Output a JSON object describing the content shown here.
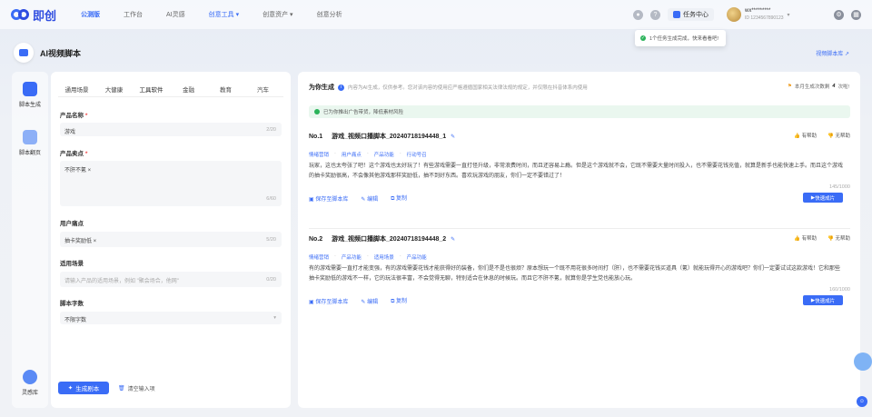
{
  "app": {
    "logo_text": "即创"
  },
  "nav": [
    {
      "label": "公测版",
      "active": true
    },
    {
      "label": "工作台"
    },
    {
      "label": "AI灵感"
    },
    {
      "label": "创意工具 ▾",
      "highlight": true
    },
    {
      "label": "创意资产 ▾"
    },
    {
      "label": "创意分析"
    }
  ],
  "top": {
    "tasks_label": "任务中心",
    "user_name": "wx*********",
    "user_sub": "ID 1234567890123"
  },
  "toast": {
    "text": "1个任务生成完成，快来看看吧!"
  },
  "page": {
    "title": "AI视频脚本",
    "tutorial_link": "视频脚本库 ↗"
  },
  "sidebar": {
    "items": [
      {
        "label": "脚本生成"
      },
      {
        "label": "脚本翻页"
      },
      {
        "label": "灵感库"
      }
    ]
  },
  "form": {
    "tabs": [
      "通用场景",
      "大健康",
      "工具软件",
      "金融",
      "教育",
      "汽车"
    ],
    "product_name_label": "产品名称",
    "product_name_value": "游戏",
    "product_name_count": "2/20",
    "selling_points_label": "产品卖点",
    "selling_points_value": "不肝不氪 ×",
    "selling_points_count": "6/60",
    "pain_points_label": "用户痛点",
    "pain_points_value": "抽卡奖励低 ×",
    "pain_points_count": "5/20",
    "scene_label": "适用场景",
    "scene_placeholder": "请输入产品的适用场景，例如 \"聚会场合，他网\"",
    "scene_count": "0/20",
    "word_count_label": "脚本字数",
    "word_count_value": "不限字数",
    "generate_label": "生成剧本",
    "clear_label": "清空输入项"
  },
  "results": {
    "title": "为你生成",
    "note": "内容为AI生成，仅供参考。您对该内容的使用应严格遵循国家相关法律法规的规定，并仅限在抖音体系内使用",
    "remain_prefix": "本月生成次数剩",
    "remain_count": "4",
    "remain_suffix": "次啦!",
    "tip": "已为你推出广告带货，降低素材风险",
    "scripts": [
      {
        "no": "No.1",
        "name": "游戏_视频口播脚本_20240718194448_1",
        "like": "有帮助",
        "dislike": "无帮助",
        "tags": [
          "情绪营销",
          "用户痛点",
          "产品功能",
          "行动号召"
        ],
        "body": "玩家，这也太夸张了吧！这个游戏也太好玩了！有些游戏需要一直打怪升级，非常浪费时间，而且还容易上瘾。但是这个游戏就不会，它既不需要大量时间投入，也不需要花钱充值，就算是新手也能快速上手。而且这个游戏的抽卡奖励很高，不会像其他游戏那样奖励低，抽不到好东西。喜欢玩游戏的朋友，你们一定不要错过了！",
        "count": "145/1000",
        "save": "保存至脚本库",
        "edit": "编辑",
        "copy": "复制",
        "quick": "快速成片"
      },
      {
        "no": "No.2",
        "name": "游戏_视频口播脚本_20240718194448_2",
        "like": "有帮助",
        "dislike": "无帮助",
        "tags": [
          "情绪营销",
          "产品功能",
          "适用场景",
          "产品功能"
        ],
        "body": "有的游戏需要一直打才能变强，有的游戏需要花钱才能获得好的装备，你们是不是也很烦？原本想玩一个既不用花很多时间打（肝），也不需要花钱买道具（氪）就能玩得开心的游戏吧？你们一定要试试这款游戏！它和那些抽卡奖励低的游戏不一样，它的玩法很丰富，不会觉得无聊，特别适合在休息的时候玩。而且它不肝不氪，就算你是学生党也能放心玩。",
        "count": "160/1000",
        "save": "保存至脚本库",
        "edit": "编辑",
        "copy": "复制",
        "quick": "快速成片"
      }
    ]
  },
  "icons": {
    "accent": "#3a6cf6",
    "success": "#2bb35a"
  }
}
